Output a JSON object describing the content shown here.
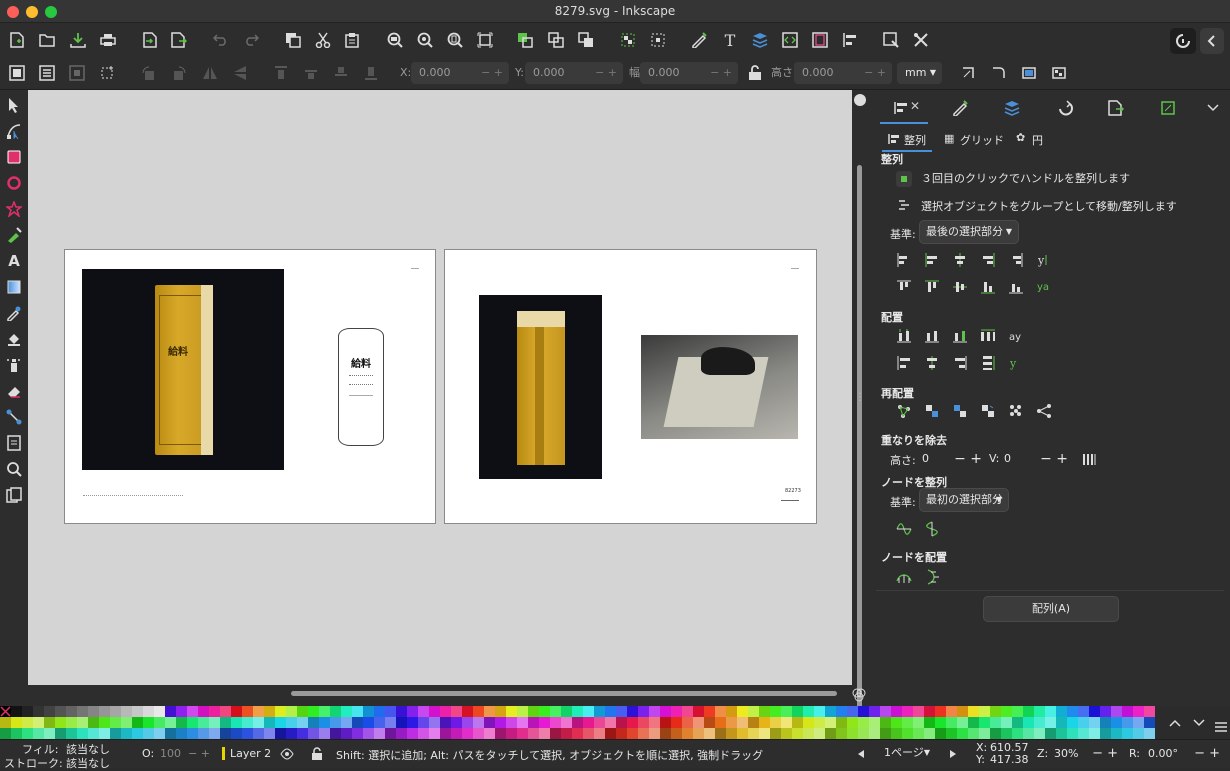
{
  "window": {
    "title": "8279.svg - Inkscape"
  },
  "controls": {
    "x_label": "X:",
    "x_value": "0.000",
    "y_label": "Y:",
    "y_value": "0.000",
    "w_label": "幅:",
    "w_value": "0.000",
    "h_label": "高さ:",
    "h_value": "0.000",
    "unit": "mm"
  },
  "dock": {
    "tabs": {
      "align": "整列",
      "grid": "グリッド",
      "circle": "円"
    },
    "sections": {
      "align": "整列",
      "distribute": "配置",
      "rearrange": "再配置",
      "overlap": "重なりを除去",
      "align_nodes": "ノードを整列",
      "distribute_nodes": "ノードを配置"
    },
    "option_handles": "３回目のクリックでハンドルを整列します",
    "option_group": "選択オブジェクトをグループとして移動/整列します",
    "relative_label": "基準:",
    "relative_value": "最後の選択部分",
    "overlap_h_label": "高さ:",
    "overlap_h_value": "0",
    "overlap_v_label": "V:",
    "overlap_v_value": "0",
    "nodes_relative_label": "基準:",
    "nodes_relative_value": "最初の選択部分",
    "arrange_button": "配列(A)"
  },
  "document": {
    "envelope_title": "給料",
    "outline_title": "給料",
    "page_number_right": "82273"
  },
  "status": {
    "fill_label": "フィル:",
    "fill_value": "該当なし",
    "stroke_label": "ストローク:",
    "stroke_value": "該当なし",
    "opacity_label": "O:",
    "opacity_value": "100",
    "layer": "Layer 2",
    "message": "Shift: 選択に追加; Alt: パスをタッチして選択, オブジェクトを順に選択, 強制ドラッグ",
    "page": "1ページ",
    "x_label": "X:",
    "x_value": "610.57",
    "y_label": "Y:",
    "y_value": "417.38",
    "zoom_label": "Z:",
    "zoom_value": "30%",
    "rotate_label": "R:",
    "rotate_value": "0.00°"
  },
  "colors": {
    "accent": "#4a90d9",
    "layer_indicator": "#e8d400",
    "window_bg": "#2d2d2d",
    "canvas_bg": "#d4d4d4"
  }
}
